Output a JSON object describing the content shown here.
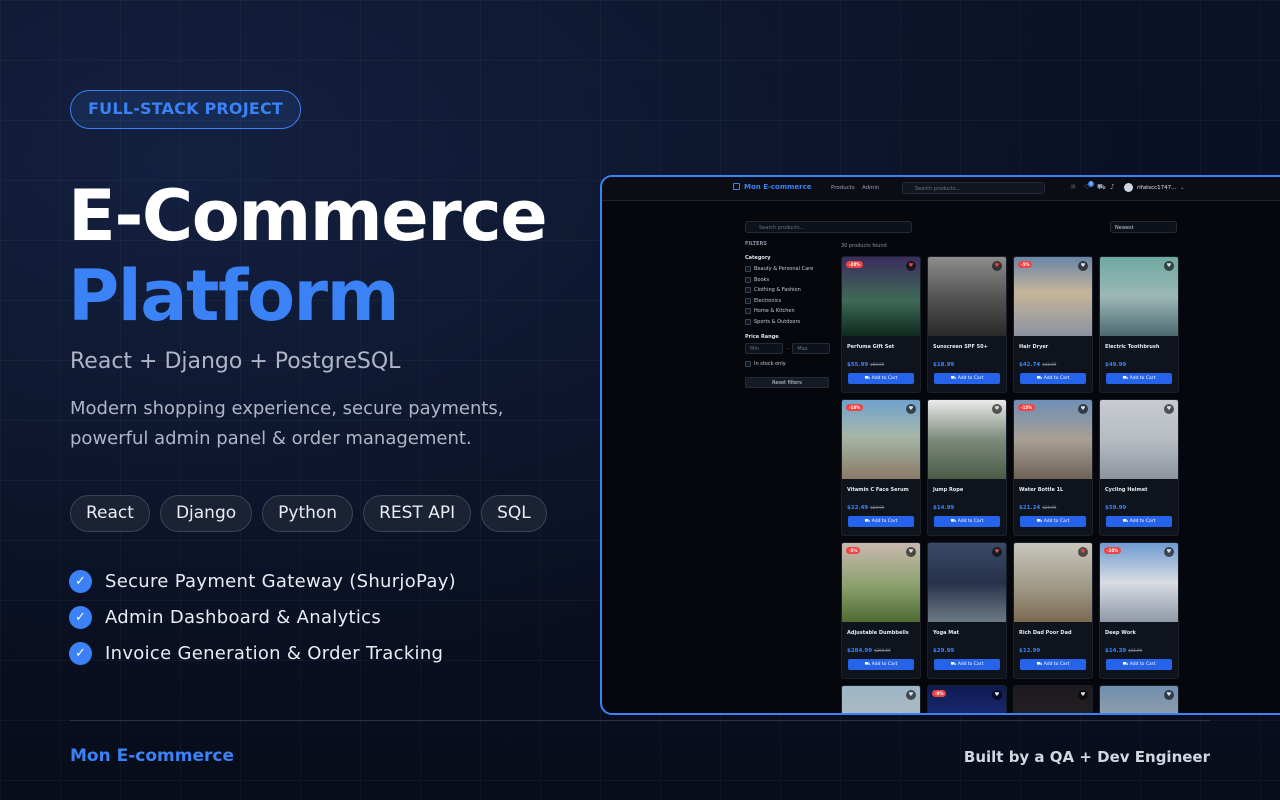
{
  "badge": "FULL-STACK PROJECT",
  "title_line1": "E-Commerce",
  "title_line2": "Platform",
  "stack": "React + Django + PostgreSQL",
  "description": "Modern shopping experience, secure payments, powerful admin panel & order management.",
  "chips": [
    "React",
    "Django",
    "Python",
    "REST API",
    "SQL"
  ],
  "features": [
    "Secure Payment Gateway (ShurjoPay)",
    "Admin Dashboard & Analytics",
    "Invoice Generation & Order Tracking"
  ],
  "footer_left": "Mon E-commerce",
  "footer_right": "Built by a QA + Dev Engineer",
  "accent": "#3b82f6",
  "screenshot": {
    "brand": "Mon E-commerce",
    "nav_links": [
      "Products",
      "Admin"
    ],
    "nav_search_placeholder": "Search products...",
    "cart_badge": "0",
    "user": "rifatscc1747...",
    "search_placeholder": "Search products...",
    "sort": "Newest",
    "filters_title": "FILTERS",
    "category_title": "Category",
    "categories": [
      "Beauty & Personal Care",
      "Books",
      "Clothing & Fashion",
      "Electronics",
      "Home & Kitchen",
      "Sports & Outdoors"
    ],
    "price_title": "Price Range",
    "min_placeholder": "Min",
    "max_placeholder": "Max",
    "price_dash": "-",
    "in_stock": "In stock only",
    "reset": "Reset filters",
    "count": "30 products found",
    "add_to_cart": "Add to Cart",
    "products": [
      {
        "name": "Perfume Gift Set",
        "price": "$55.99",
        "old": "$69.99",
        "discount": "-20%",
        "heart": "red"
      },
      {
        "name": "Sunscreen SPF 50+",
        "price": "$18.99",
        "old": "",
        "discount": "",
        "heart": "red"
      },
      {
        "name": "Hair Dryer",
        "price": "$42.74",
        "old": "$44.99",
        "discount": "-5%",
        "heart": "white"
      },
      {
        "name": "Electric Toothbrush",
        "price": "$49.99",
        "old": "",
        "discount": "",
        "heart": "white"
      },
      {
        "name": "Vitamin C Face Serum",
        "price": "$22.49",
        "old": "$24.99",
        "discount": "-10%",
        "heart": "white"
      },
      {
        "name": "Jump Rope",
        "price": "$14.99",
        "old": "",
        "discount": "",
        "heart": "white"
      },
      {
        "name": "Water Bottle 1L",
        "price": "$21.24",
        "old": "$24.99",
        "discount": "-15%",
        "heart": "white"
      },
      {
        "name": "Cycling Helmet",
        "price": "$59.99",
        "old": "",
        "discount": "",
        "heart": "white"
      },
      {
        "name": "Adjustable Dumbbells",
        "price": "$284.99",
        "old": "$299.99",
        "discount": "-5%",
        "heart": "white"
      },
      {
        "name": "Yoga Mat",
        "price": "$29.99",
        "old": "",
        "discount": "",
        "heart": "red"
      },
      {
        "name": "Rich Dad Poor Dad",
        "price": "$12.99",
        "old": "",
        "discount": "",
        "heart": "red"
      },
      {
        "name": "Deep Work",
        "price": "$14.39",
        "old": "$15.99",
        "discount": "-10%",
        "heart": "white"
      },
      {
        "name": "",
        "price": "",
        "old": "",
        "discount": "",
        "heart": "white"
      },
      {
        "name": "",
        "price": "",
        "old": "",
        "discount": "-9%",
        "heart": "white"
      },
      {
        "name": "",
        "price": "",
        "old": "",
        "discount": "",
        "heart": "white"
      },
      {
        "name": "",
        "price": "",
        "old": "",
        "discount": "",
        "heart": "white"
      }
    ]
  }
}
